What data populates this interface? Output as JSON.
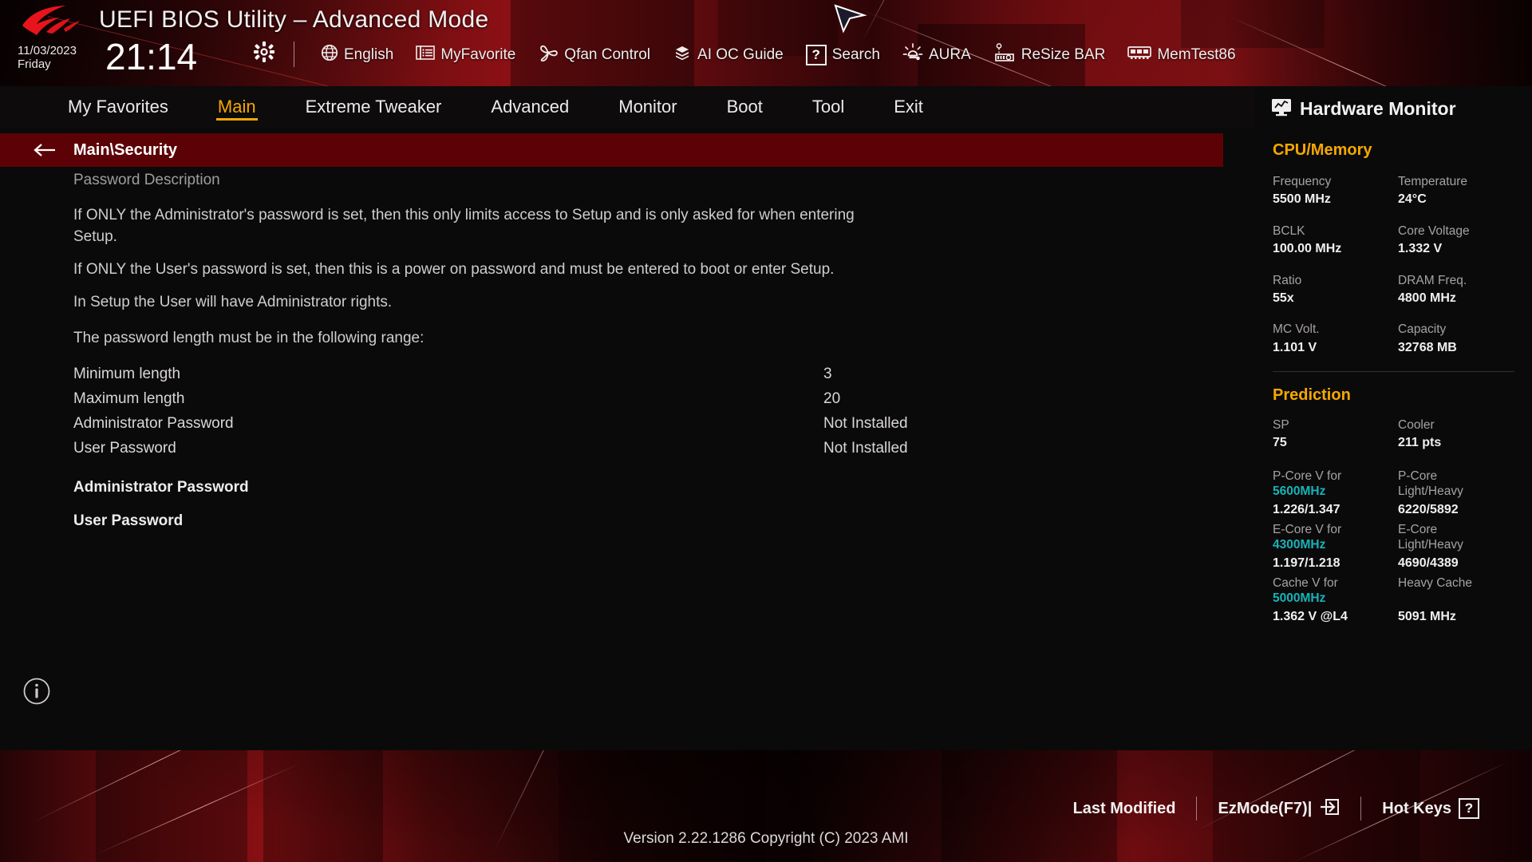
{
  "header": {
    "title": "UEFI BIOS Utility – Advanced Mode",
    "logo_icon": "rog-logo-icon",
    "date": "11/03/2023",
    "weekday": "Friday",
    "time": "21:14",
    "settings_icon": "gear-icon",
    "tools": [
      {
        "label": "English",
        "icon": "globe-icon"
      },
      {
        "label": "MyFavorite",
        "icon": "favorite-list-icon"
      },
      {
        "label": "Qfan Control",
        "icon": "fan-icon"
      },
      {
        "label": "AI OC Guide",
        "icon": "ai-chip-icon"
      },
      {
        "label": "Search",
        "icon": "question-box-icon"
      },
      {
        "label": "AURA",
        "icon": "light-bulb-icon"
      },
      {
        "label": "ReSize BAR",
        "icon": "gpu-card-icon"
      },
      {
        "label": "MemTest86",
        "icon": "memory-module-icon"
      }
    ]
  },
  "tabs": [
    {
      "label": "My Favorites",
      "active": false
    },
    {
      "label": "Main",
      "active": true
    },
    {
      "label": "Extreme Tweaker",
      "active": false
    },
    {
      "label": "Advanced",
      "active": false
    },
    {
      "label": "Monitor",
      "active": false
    },
    {
      "label": "Boot",
      "active": false
    },
    {
      "label": "Tool",
      "active": false
    },
    {
      "label": "Exit",
      "active": false
    }
  ],
  "breadcrumb": {
    "back_icon": "back-arrow-icon",
    "path": "Main\\Security"
  },
  "main": {
    "section_heading": "Password Description",
    "paragraphs": [
      "If ONLY the Administrator's password is set, then this only limits access to Setup and is only asked for when entering Setup.",
      "If ONLY the User's password is set, then this is a power on password and must be entered to boot or enter Setup.",
      "In Setup the User will have Administrator rights.",
      "The password length must be in the following range:"
    ],
    "rows": [
      {
        "label": "Minimum length",
        "value": "3"
      },
      {
        "label": "Maximum length",
        "value": "20"
      },
      {
        "label": "Administrator Password",
        "value": "Not Installed"
      },
      {
        "label": "User Password",
        "value": "Not Installed"
      }
    ],
    "actions": [
      {
        "label": "Administrator Password"
      },
      {
        "label": "User Password"
      }
    ],
    "info_icon": "info-icon"
  },
  "hardware_monitor": {
    "title": "Hardware Monitor",
    "title_icon": "monitor-graph-icon",
    "sections": [
      {
        "name": "CPU/Memory",
        "pairs": [
          [
            {
              "key": "Frequency",
              "value": "5500 MHz"
            },
            {
              "key": "Temperature",
              "value": "24°C"
            }
          ],
          [
            {
              "key": "BCLK",
              "value": "100.00 MHz"
            },
            {
              "key": "Core Voltage",
              "value": "1.332 V"
            }
          ],
          [
            {
              "key": "Ratio",
              "value": "55x"
            },
            {
              "key": "DRAM Freq.",
              "value": "4800 MHz"
            }
          ],
          [
            {
              "key": "MC Volt.",
              "value": "1.101 V"
            },
            {
              "key": "Capacity",
              "value": "32768 MB"
            }
          ]
        ]
      }
    ],
    "prediction": {
      "name": "Prediction",
      "pairs": [
        [
          {
            "key": "SP",
            "value": "75"
          },
          {
            "key": "Cooler",
            "value": "211 pts"
          }
        ]
      ],
      "blocks": [
        {
          "left_key": "P-Core V for",
          "left_key_hl": "5600MHz",
          "left_value": "1.226/1.347",
          "right_key": "P-Core",
          "right_key2": "Light/Heavy",
          "right_value": "6220/5892"
        },
        {
          "left_key": "E-Core V for",
          "left_key_hl": "4300MHz",
          "left_value": "1.197/1.218",
          "right_key": "E-Core",
          "right_key2": "Light/Heavy",
          "right_value": "4690/4389"
        },
        {
          "left_key": "Cache V for",
          "left_key_hl": "5000MHz",
          "left_value": "1.362 V @L4",
          "right_key": "Heavy Cache",
          "right_key2": "",
          "right_value": "5091 MHz"
        }
      ]
    }
  },
  "footer": {
    "items": [
      {
        "label": "Last Modified",
        "icon": ""
      },
      {
        "label": "EzMode(F7)|",
        "icon": "exit-arrow-icon"
      },
      {
        "label": "Hot Keys",
        "icon": "question-box-icon"
      }
    ],
    "version": "Version 2.22.1286 Copyright (C) 2023 AMI"
  },
  "colors": {
    "accent_gold": "#f5a800",
    "accent_cyan": "#16b3b8",
    "crumb_red": "#5c0206",
    "panel_bg": "#0b0a0a"
  }
}
